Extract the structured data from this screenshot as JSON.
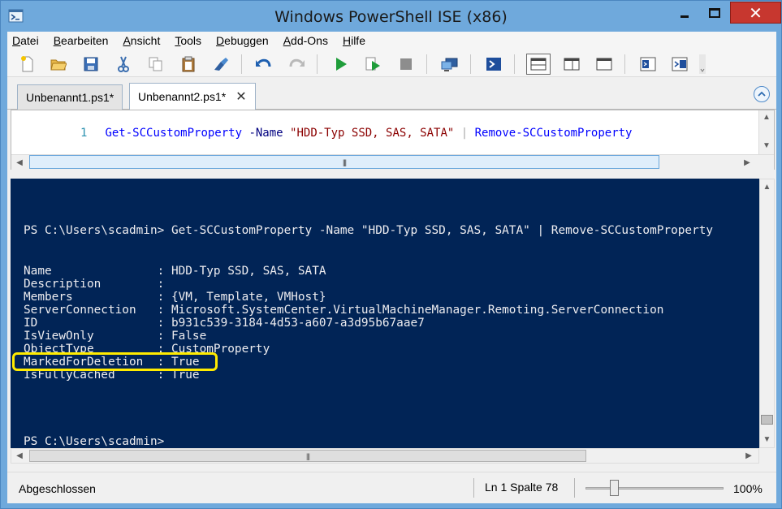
{
  "window": {
    "title": "Windows PowerShell ISE (x86)",
    "close_glyph": "✕"
  },
  "menu": [
    "Datei",
    "Bearbeiten",
    "Ansicht",
    "Tools",
    "Debuggen",
    "Add-Ons",
    "Hilfe"
  ],
  "toolbar": {
    "icons": [
      "new-icon",
      "open-icon",
      "save-icon",
      "cut-icon",
      "copy-icon",
      "paste-icon",
      "clear-icon",
      "undo-icon",
      "redo-icon",
      "run-icon",
      "run-selection-icon",
      "stop-icon",
      "remote-icon",
      "console-icon",
      "layout-top-icon",
      "layout-right-icon",
      "layout-max-icon",
      "commands-icon",
      "addon-icon"
    ]
  },
  "tabs": [
    {
      "label": "Unbenannt1.ps1*",
      "active": false
    },
    {
      "label": "Unbenannt2.ps1*",
      "active": true,
      "close": "✕"
    }
  ],
  "editor": {
    "line_number": "1",
    "tokens": {
      "cmd1": "Get-SCCustomProperty",
      "param": " -Name ",
      "str": "\"HDD-Typ SSD, SAS, SATA\"",
      "op": " | ",
      "cmd2": "Remove-SCCustomProperty"
    }
  },
  "console": {
    "command_line": "PS C:\\Users\\scadmin> Get-SCCustomProperty -Name \"HDD-Typ SSD, SAS, SATA\" | Remove-SCCustomProperty",
    "output": [
      "Name               : HDD-Typ SSD, SAS, SATA",
      "Description        :",
      "Members            : {VM, Template, VMHost}",
      "ServerConnection   : Microsoft.SystemCenter.VirtualMachineManager.Remoting.ServerConnection",
      "ID                 : b931c539-3184-4d53-a607-a3d95b67aae7",
      "IsViewOnly         : False",
      "ObjectType         : CustomProperty",
      "MarkedForDeletion  : True",
      "IsFullyCached      : True"
    ],
    "prompt": "PS C:\\Users\\scadmin>",
    "highlighted_row": "MarkedForDeletion : True"
  },
  "statusbar": {
    "status": "Abgeschlossen",
    "position": "Ln 1  Spalte 78",
    "zoom": "100%",
    "zoom_level": 1.0
  },
  "colors": {
    "console_bg": "#012456",
    "highlight": "#ffeb00",
    "title_bg": "#6fa9dc"
  }
}
